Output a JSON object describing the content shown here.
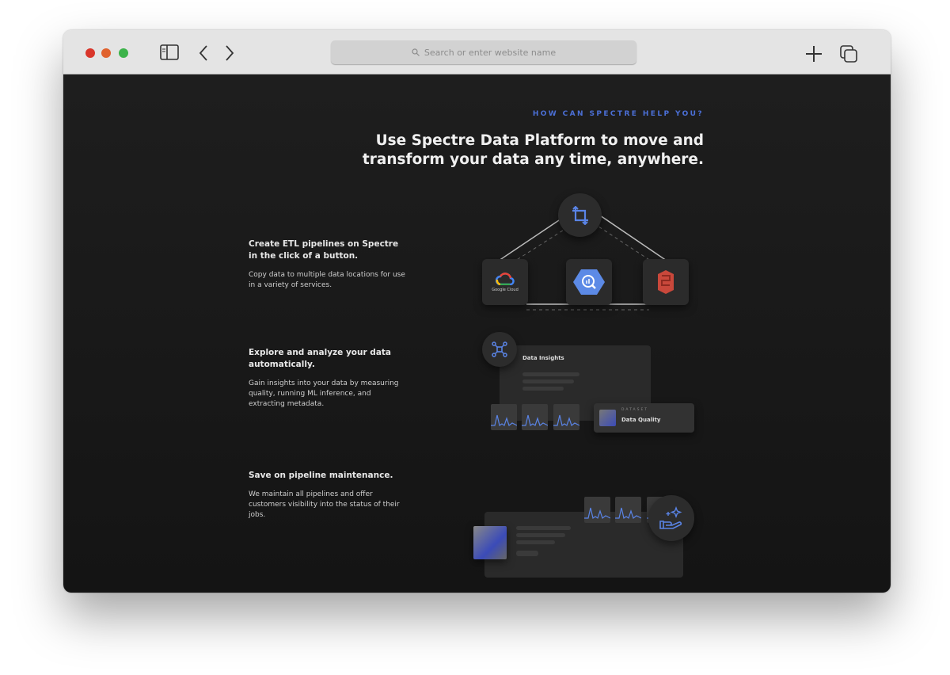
{
  "browser": {
    "url_placeholder": "Search or enter website name",
    "colors": {
      "close": "#d9362b",
      "minimize": "#e0622e",
      "zoom": "#3cb34a"
    }
  },
  "page": {
    "eyebrow": "HOW CAN SPECTRE HELP YOU?",
    "headline": "Use Spectre Data Platform to move and transform your data any time, anywhere.",
    "accent": "#4b6fd6",
    "features": [
      {
        "title": "Create ETL pipelines on Spectre in the click of a button.",
        "body": "Copy data to multiple data locations for use in a variety of services."
      },
      {
        "title": "Explore and analyze your data automatically.",
        "body": "Gain insights into your data by measuring quality, running ML inference, and extracting metadata."
      },
      {
        "title": "Save on pipeline maintenance.",
        "body": "We maintain all pipelines and offer customers visibility into the status of their jobs."
      }
    ],
    "illustration": {
      "google_cloud_label": "Google Cloud",
      "insights_title": "Data Insights",
      "dataset_label": "DATASET",
      "dataset_name": "Data Quality"
    }
  }
}
